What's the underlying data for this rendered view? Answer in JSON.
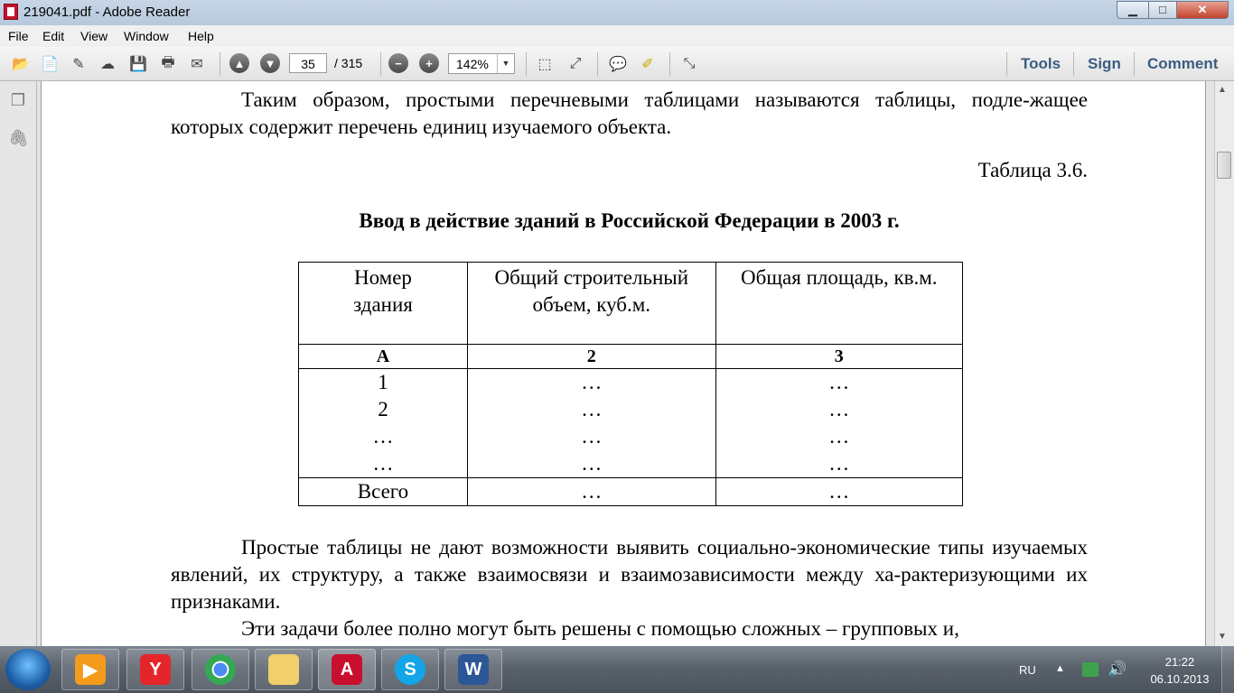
{
  "window": {
    "title": "219041.pdf - Adobe Reader",
    "min_glyph": "▁",
    "max_glyph": "□",
    "close_glyph": "✕"
  },
  "menu": {
    "items": [
      "File",
      "Edit",
      "View",
      "Window",
      "Help"
    ]
  },
  "toolbar": {
    "page_current": "35",
    "page_total": "/ 315",
    "zoom": "142%",
    "tools_label": "Tools",
    "sign_label": "Sign",
    "comment_label": "Comment"
  },
  "document": {
    "para_intro": "Таким образом, простыми перечневыми таблицами называются таблицы, подле-жащее которых содержит перечень единиц изучаемого объекта.",
    "table_caption": "Таблица 3.6.",
    "table_title": "Ввод в действие зданий в Российской Федерации в 2003 г.",
    "table": {
      "headers": [
        "Номер здания",
        "Общий строительный объем, куб.м.",
        "Общая площадь, кв.м."
      ],
      "col_numbers": [
        "А",
        "2",
        "3"
      ],
      "rows": [
        [
          "1",
          "…",
          "…"
        ],
        [
          "2",
          "…",
          "…"
        ],
        [
          "…",
          "…",
          "…"
        ],
        [
          "…",
          "…",
          "…"
        ]
      ],
      "total_row": [
        "Всего",
        "…",
        "…"
      ]
    },
    "para_simple": "Простые таблицы не дают возможности выявить социально-экономические типы изучаемых явлений, их структуру, а также взаимосвязи и взаимозависимости между ха-рактеризующими их признаками.",
    "para_tasks": "Эти задачи более полно могут быть решены с помощью сложных – групповых и,"
  },
  "taskbar": {
    "apps": [
      "media-player",
      "yandex",
      "chrome",
      "explorer",
      "adobe-reader",
      "skype",
      "word"
    ],
    "lang": "RU",
    "time": "21:22",
    "date": "06.10.2013"
  }
}
